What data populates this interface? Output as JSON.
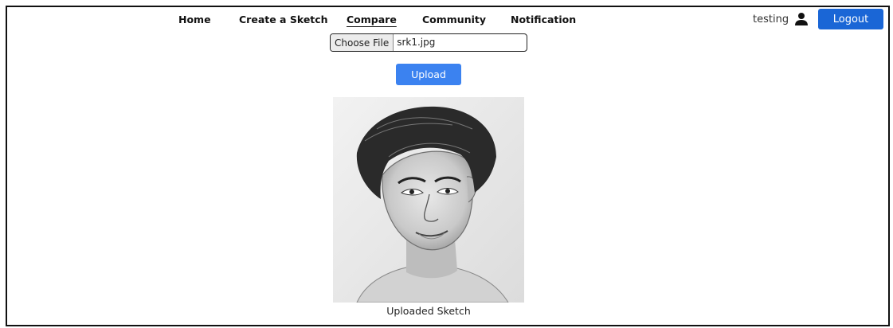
{
  "nav": {
    "items": [
      {
        "label": "Home"
      },
      {
        "label": "Create a Sketch"
      },
      {
        "label": "Compare"
      },
      {
        "label": "Community"
      },
      {
        "label": "Notification"
      }
    ]
  },
  "user": {
    "name": "testing",
    "icon": "user-icon",
    "logout_label": "Logout"
  },
  "upload_form": {
    "choose_label": "Choose File",
    "file_name": "srk1.jpg",
    "upload_label": "Upload"
  },
  "preview": {
    "caption": "Uploaded Sketch"
  },
  "colors": {
    "logout_bg": "#1a66d6",
    "upload_bg": "#3b82f0"
  }
}
